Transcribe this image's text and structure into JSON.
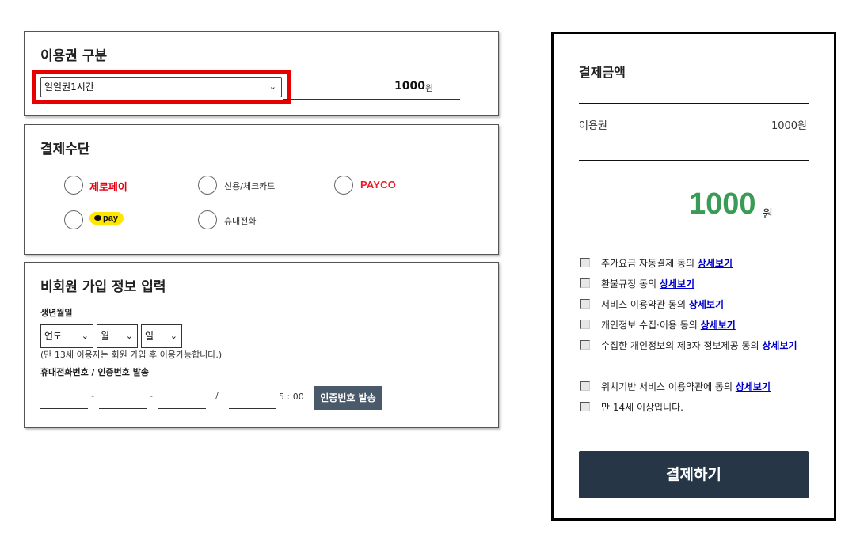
{
  "ticket_section": {
    "title": "이용권 구분",
    "selected_option": "일일권1시간",
    "price": "1000",
    "price_unit": "원"
  },
  "payment_section": {
    "title": "결제수단",
    "methods": [
      {
        "label": "제로페이",
        "brand_color": "#e60012"
      },
      {
        "label": "신용/체크카드"
      },
      {
        "label": "PAYCO",
        "brand_color": "#ea1d2c"
      },
      {
        "label": "pay",
        "brand_color": "#ffe600"
      },
      {
        "label": "휴대전화"
      }
    ]
  },
  "member_section": {
    "title": "비회원 가입 정보 입력",
    "birth_label": "생년월일",
    "year_select": "연도",
    "month_select": "월",
    "day_select": "일",
    "age_note": "(만 13세 이용자는 회원 가입 후 이용가능합니다.)",
    "phone_label": "휴대전화번호 / 인증번호 발송",
    "dash": "-",
    "slash": "/",
    "timer": "5 : 00",
    "verify_button": "인증번호 발송"
  },
  "summary": {
    "title": "결제금액",
    "row_label": "이용권",
    "row_value": "1000원",
    "total": "1000",
    "total_unit": "원",
    "agreements": [
      {
        "text": "추가요금 자동결제 동의",
        "link": "상세보기"
      },
      {
        "text": "환불규정 동의",
        "link": "상세보기"
      },
      {
        "text": "서비스 이용약관 동의",
        "link": "상세보기"
      },
      {
        "text": "개인정보 수집·이용 동의",
        "link": "상세보기"
      },
      {
        "text": "수집한 개인정보의 제3자 정보제공 동의",
        "link": "상세보기"
      },
      {
        "text": "위치기반 서비스 이용약관에 동의",
        "link": "상세보기"
      },
      {
        "text": "만 14세 이상입니다.",
        "link": ""
      }
    ],
    "pay_button": "결제하기",
    "accent_color": "#3a9b57"
  }
}
